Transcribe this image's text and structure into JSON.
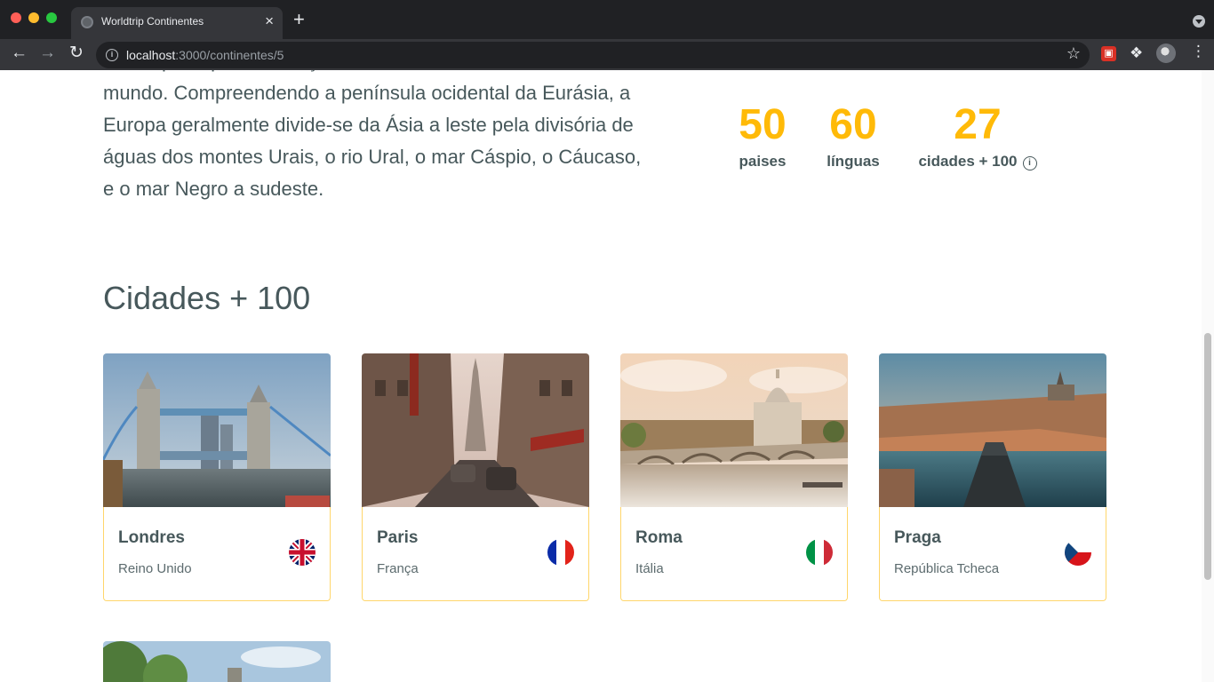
{
  "browser": {
    "tab_title": "Worldtrip Continentes",
    "tab_close": "×",
    "new_tab": "+",
    "url_host": "localhost",
    "url_path": ":3000/continentes/5"
  },
  "description": "A Europa é, por convenção, um dos seis continentes do mundo. Compreendendo a península ocidental da Eurásia, a Europa geralmente divide-se da Ásia a leste pela divisória de águas dos montes Urais, o rio Ural, o mar Cáspio, o Cáucaso, e o mar Negro a sudeste.",
  "stats": [
    {
      "value": "50",
      "label": "paises"
    },
    {
      "value": "60",
      "label": "línguas"
    },
    {
      "value": "27",
      "label": "cidades + 100"
    }
  ],
  "section_title": "Cidades + 100",
  "cities": [
    {
      "city": "Londres",
      "country": "Reino Unido",
      "flag": "uk-flag-icon"
    },
    {
      "city": "Paris",
      "country": "França",
      "flag": "france-flag-icon"
    },
    {
      "city": "Roma",
      "country": "Itália",
      "flag": "italy-flag-icon"
    },
    {
      "city": "Praga",
      "country": "República Tcheca",
      "flag": "czech-flag-icon"
    }
  ],
  "colors": {
    "accent": "#ffba08",
    "text": "#47585b",
    "card_border": "#ffd66b"
  }
}
